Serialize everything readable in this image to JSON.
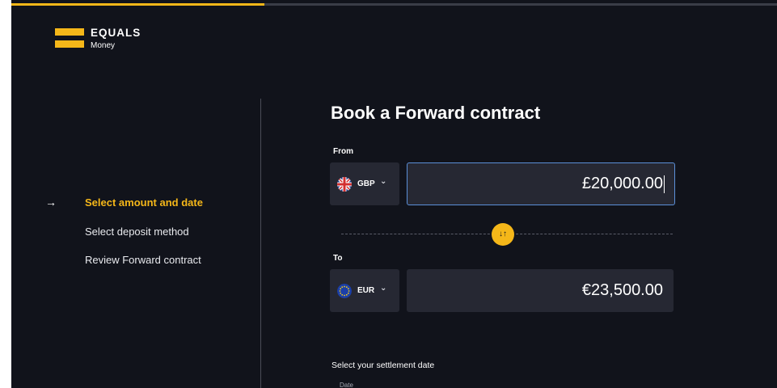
{
  "progress": {
    "fraction": 0.33
  },
  "brand": {
    "name": "EQUALS",
    "sub": "Money",
    "color": "#f5b719"
  },
  "steps": [
    {
      "label": "Select amount and date",
      "active": true,
      "icon": "arrow-right-icon",
      "arrow": "→"
    },
    {
      "label": "Select deposit method",
      "active": false
    },
    {
      "label": "Review Forward contract",
      "active": false
    }
  ],
  "form": {
    "title": "Book a Forward contract",
    "from": {
      "label": "From",
      "currency": "GBP",
      "flag": "uk-flag-icon",
      "amount": "£20,000.00"
    },
    "swap": {
      "icon": "swap-arrows-icon",
      "glyph": "↓↑"
    },
    "to": {
      "label": "To",
      "currency": "EUR",
      "flag": "eu-flag-icon",
      "amount": "€23,500.00"
    },
    "settlement": {
      "label": "Select your settlement date",
      "date_label": "Date"
    }
  },
  "chevron": "⌄"
}
